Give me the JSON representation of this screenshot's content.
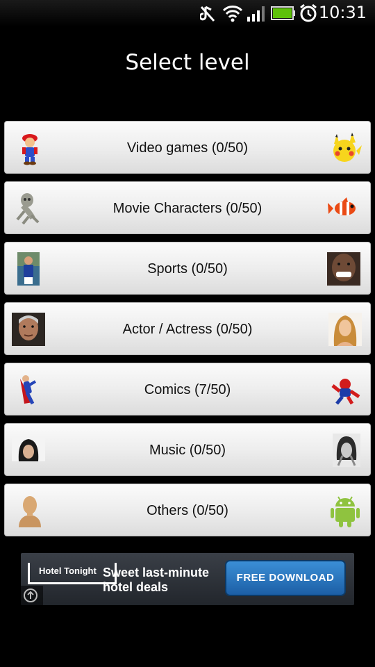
{
  "status_bar": {
    "time": "10:31",
    "icons": [
      "mute-icon",
      "wifi-icon",
      "signal-icon",
      "battery-icon",
      "alarm-icon"
    ],
    "battery_color": "#5ec10a"
  },
  "title": "Select level",
  "levels": [
    {
      "label": "Video games (0/50)",
      "left_icon": "mario-icon",
      "right_icon": "pikachu-icon"
    },
    {
      "label": "Movie Characters (0/50)",
      "left_icon": "gollum-icon",
      "right_icon": "clownfish-icon"
    },
    {
      "label": "Sports (0/50)",
      "left_icon": "tennis-player-icon",
      "right_icon": "boxer-icon"
    },
    {
      "label": "Actor / Actress (0/50)",
      "left_icon": "actor-photo-icon",
      "right_icon": "actress-photo-icon"
    },
    {
      "label": "Comics (7/50)",
      "left_icon": "superman-icon",
      "right_icon": "spiderman-icon"
    },
    {
      "label": "Music (0/50)",
      "left_icon": "singer-photo-icon",
      "right_icon": "musician-photo-icon"
    },
    {
      "label": "Others (0/50)",
      "left_icon": "bust-statue-icon",
      "right_icon": "android-robot-icon"
    }
  ],
  "ad": {
    "brand": "Hotel Tonight",
    "headline": "Sweet last-minute hotel deals",
    "cta": "FREE DOWNLOAD"
  }
}
